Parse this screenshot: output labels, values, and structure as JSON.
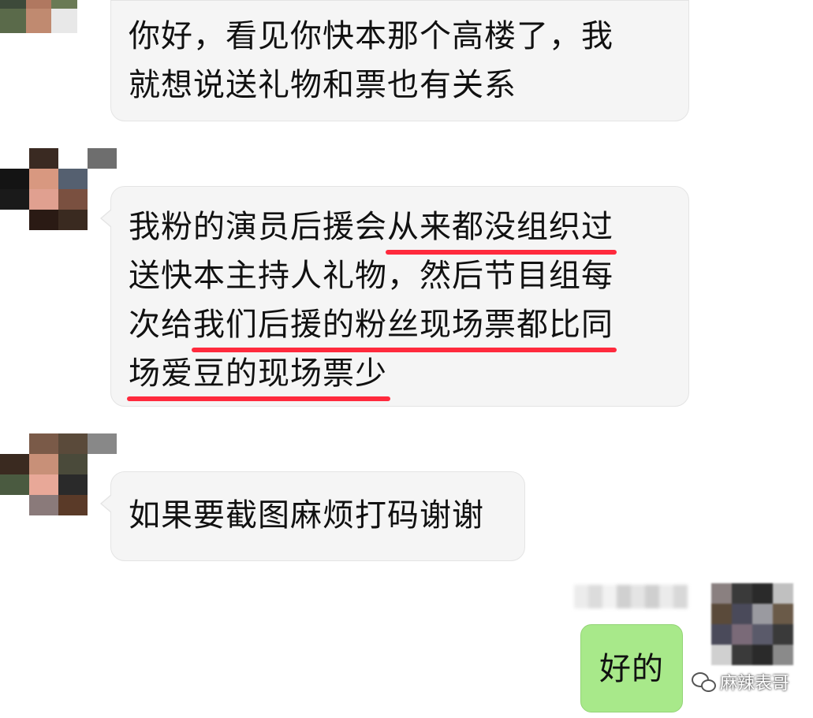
{
  "messages": [
    {
      "lines": [
        "你好，看见你快本那个高楼了，我",
        "就想说送礼物和票也有关系"
      ]
    },
    {
      "line1_plain": "我粉的演员后援会",
      "line1_marked": "从来都没组织过",
      "line2_plain": "送快本主持人礼物，然后节目组每",
      "line3_plain": "次给",
      "line3_marked": "我们后援的粉丝现场票都比同",
      "line4_marked": "场爱豆的现场票少"
    },
    {
      "lines": [
        "如果要截图麻烦打码谢谢"
      ]
    }
  ],
  "reply": {
    "text": "好的"
  },
  "watermark": {
    "text": "麻辣表哥",
    "icon": "wechat-icon"
  },
  "colors": {
    "incoming_bubble": "#f5f5f5",
    "outgoing_bubble": "#a8e98a",
    "underline": "#ff2a3d"
  }
}
